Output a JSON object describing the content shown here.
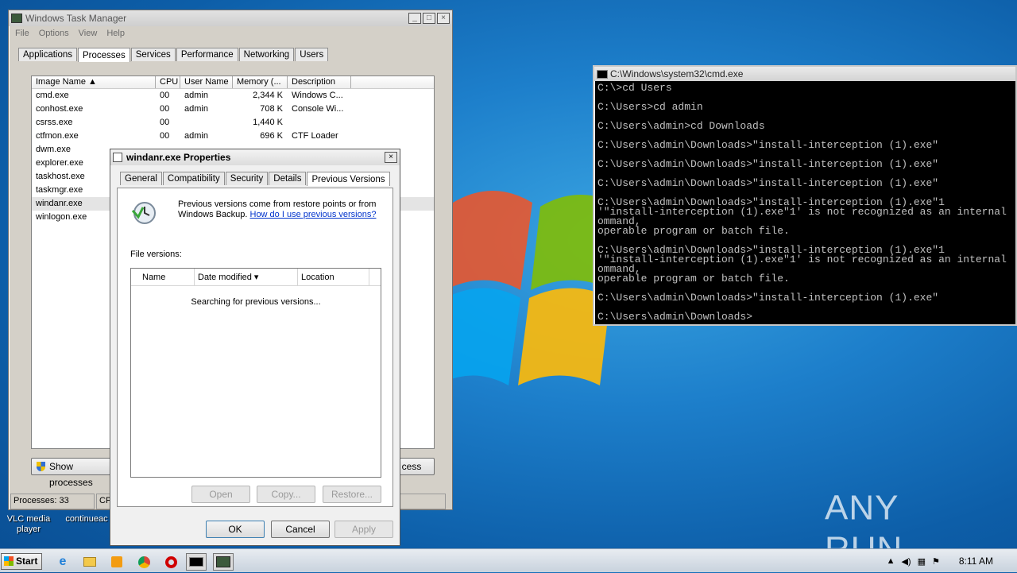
{
  "colors": {
    "desktop": "#1d7fcb",
    "selection_row": "#e4e4e4",
    "link": "#0033cc",
    "cmd_text": "#c0c0c0"
  },
  "desktop": {
    "icons": [
      {
        "label": "VLC media player",
        "icon": "vlc-icon"
      },
      {
        "label": "continueac",
        "icon": "file-icon"
      }
    ],
    "watermark": "ANY RUN"
  },
  "task_manager": {
    "title": "Windows Task Manager",
    "menu": [
      "File",
      "Options",
      "View",
      "Help"
    ],
    "tabs": [
      "Applications",
      "Processes",
      "Services",
      "Performance",
      "Networking",
      "Users"
    ],
    "selected_tab": "Processes",
    "columns": [
      "Image Name",
      "CPU",
      "User Name",
      "Memory (...",
      "Description"
    ],
    "rows": [
      {
        "name": "cmd.exe",
        "cpu": "00",
        "user": "admin",
        "memory": "2,344 K",
        "desc": "Windows C..."
      },
      {
        "name": "conhost.exe",
        "cpu": "00",
        "user": "admin",
        "memory": "708 K",
        "desc": "Console Wi..."
      },
      {
        "name": "csrss.exe",
        "cpu": "00",
        "user": "",
        "memory": "1,440 K",
        "desc": ""
      },
      {
        "name": "ctfmon.exe",
        "cpu": "00",
        "user": "admin",
        "memory": "696 K",
        "desc": "CTF Loader"
      },
      {
        "name": "dwm.exe",
        "cpu": "",
        "user": "",
        "memory": "",
        "desc": ""
      },
      {
        "name": "explorer.exe",
        "cpu": "",
        "user": "",
        "memory": "",
        "desc": ""
      },
      {
        "name": "taskhost.exe",
        "cpu": "",
        "user": "",
        "memory": "",
        "desc": ""
      },
      {
        "name": "taskmgr.exe",
        "cpu": "",
        "user": "",
        "memory": "",
        "desc": ""
      },
      {
        "name": "windanr.exe",
        "cpu": "",
        "user": "",
        "memory": "",
        "desc": ""
      },
      {
        "name": "winlogon.exe",
        "cpu": "",
        "user": "",
        "memory": "",
        "desc": ""
      }
    ],
    "show_processes_label": "Show processes",
    "end_process_label": "cess",
    "status": {
      "processes": "Processes: 33",
      "cpu": "CPU"
    }
  },
  "cmd": {
    "title": "C:\\Windows\\system32\\cmd.exe",
    "lines": [
      "C:\\>cd Users",
      "",
      "C:\\Users>cd admin",
      "",
      "C:\\Users\\admin>cd Downloads",
      "",
      "C:\\Users\\admin\\Downloads>\"install-interception (1).exe\"",
      "",
      "C:\\Users\\admin\\Downloads>\"install-interception (1).exe\"",
      "",
      "C:\\Users\\admin\\Downloads>\"install-interception (1).exe\"",
      "",
      "C:\\Users\\admin\\Downloads>\"install-interception (1).exe\"1",
      "'\"install-interception (1).exe\"1' is not recognized as an internal",
      "ommand,",
      "operable program or batch file.",
      "",
      "C:\\Users\\admin\\Downloads>\"install-interception (1).exe\"1",
      "'\"install-interception (1).exe\"1' is not recognized as an internal",
      "ommand,",
      "operable program or batch file.",
      "",
      "C:\\Users\\admin\\Downloads>\"install-interception (1).exe\"",
      "",
      "C:\\Users\\admin\\Downloads>"
    ]
  },
  "props": {
    "title": "windanr.exe Properties",
    "tabs": [
      "General",
      "Compatibility",
      "Security",
      "Details",
      "Previous Versions"
    ],
    "selected_tab": "Previous Versions",
    "info_text": "Previous versions come from restore points or from Windows Backup.",
    "help_link": "How do I use previous versions?",
    "file_versions_label": "File versions:",
    "columns": [
      "Name",
      "Date modified",
      "Location"
    ],
    "searching": "Searching for previous versions...",
    "actions": {
      "open": "Open",
      "copy": "Copy...",
      "restore": "Restore..."
    },
    "buttons": {
      "ok": "OK",
      "cancel": "Cancel",
      "apply": "Apply"
    }
  },
  "taskbar": {
    "start": "Start",
    "apps": [
      "ie-icon",
      "folder-icon",
      "media-player-icon",
      "chrome-icon",
      "opera-icon",
      "cmd-icon",
      "task-manager-icon"
    ],
    "time": "8:11 AM"
  }
}
